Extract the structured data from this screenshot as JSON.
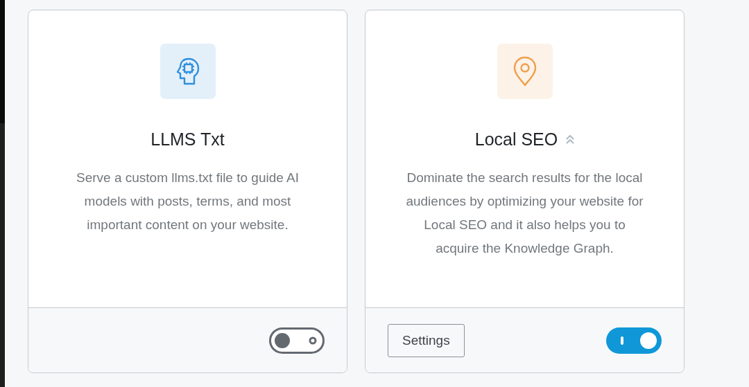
{
  "modules": [
    {
      "kind": "head",
      "color": "#2f8fdd",
      "title": "LLMS Txt",
      "badge": false,
      "description": "Serve a custom llms.txt file to guide AI models with posts, terms, and most important content on your website.",
      "on": false
    },
    {
      "kind": "pin",
      "color": "#eea04e",
      "title": "Local SEO",
      "badge": true,
      "description": "Dominate the search results for the local audiences by optimizing your website for Local SEO and it also helps you to acquire the Knowledge Graph.",
      "button": "Settings",
      "on": true
    }
  ]
}
